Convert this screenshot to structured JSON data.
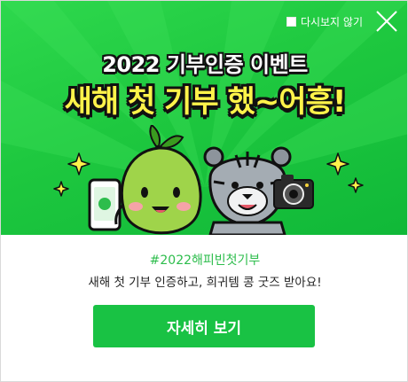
{
  "header": {
    "dont_show_label": "다시보지 않기",
    "close_icon": "close-icon"
  },
  "banner": {
    "title_sub": "2022 기부인증 이벤트",
    "title_main": "새해 첫 기부 했~어흥!",
    "colors": {
      "background": "#1ec83f",
      "title_main": "#fff34a",
      "title_sub": "#ffffff"
    },
    "illustration": [
      "bean-character",
      "phone",
      "tiger-character",
      "camera",
      "sparkle-icon"
    ]
  },
  "body": {
    "hashtag": "#2022해피빈첫기부",
    "description": "새해 첫 기부 인증하고, 희귀템 콩 굿즈 받아요!",
    "cta_label": "자세히 보기",
    "colors": {
      "hashtag": "#2dbd4c",
      "cta": "#19c244"
    }
  }
}
